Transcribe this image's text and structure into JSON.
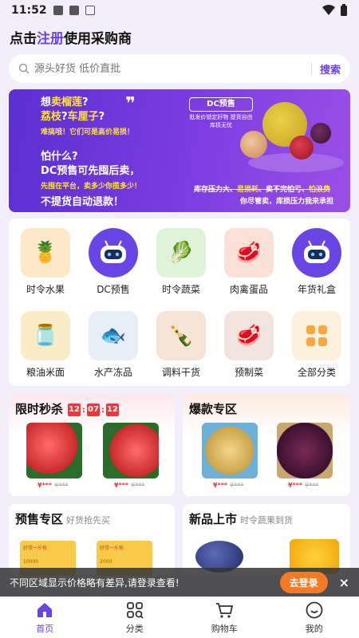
{
  "statusbar": {
    "time": "11:52"
  },
  "header": {
    "title_prefix": "点击",
    "title_link": "注册",
    "title_suffix": "使用采购商"
  },
  "search": {
    "placeholder": "源头好货 低价直批",
    "button": "搜索"
  },
  "banner": {
    "line1a": "想",
    "line1b": "卖榴莲",
    "line1c": "?",
    "line1d": "荔枝",
    "line1e": "?",
    "line1f": "车厘子",
    "line1g": "?",
    "line2": "难搞哦！它们可是高价易损！",
    "line3a": "怕什么?",
    "line3b": "DC预售可先囤后卖，",
    "line4": "先囤在平台，卖多少你揽多少！",
    "line5": "不提货自动退款！",
    "badge": "DC预售",
    "sub1": "批发价锁定好物 提货自由库损无忧",
    "strike_a": "库存压力大、",
    "strike_b": "易损耗",
    "strike_c": "、卖不完怕亏、",
    "strike_d": "怕浪费",
    "sub2": "你尽管卖，库损压力我来承担"
  },
  "categories": [
    {
      "label": "时令水果",
      "icon": "pineapple-icon",
      "color": "#fde9c8"
    },
    {
      "label": "DC预售",
      "icon": "robot-icon",
      "color": "#6a45e6"
    },
    {
      "label": "时令蔬菜",
      "icon": "vegetable-icon",
      "color": "#dff3d8"
    },
    {
      "label": "肉禽蛋品",
      "icon": "meat-icon",
      "color": "#fbe0d8"
    },
    {
      "label": "年货礼盒",
      "icon": "robot-icon",
      "color": "#6a45e6"
    },
    {
      "label": "粮油米面",
      "icon": "oil-icon",
      "color": "#fbecc8"
    },
    {
      "label": "水产冻品",
      "icon": "fish-icon",
      "color": "#e8eef5"
    },
    {
      "label": "调料干货",
      "icon": "bottle-icon",
      "color": "#f5e4d5"
    },
    {
      "label": "预制菜",
      "icon": "steak-icon",
      "color": "#f2e5e0"
    },
    {
      "label": "全部分类",
      "icon": "grid-icon",
      "color": "#fdf0dc"
    }
  ],
  "flash": {
    "title": "限时秒杀",
    "h": "12",
    "m": "07",
    "s": "12",
    "price": "¥***",
    "old": "¥***"
  },
  "hot": {
    "title": "爆款专区",
    "price": "¥***",
    "old": "¥***"
  },
  "presale": {
    "title": "预售专区",
    "sub": "好货抢先买",
    "card1": "好货一斤抢",
    "card2": "好货一斤抢",
    "num1": "10000",
    "num2": "2000"
  },
  "newarr": {
    "title": "新品上市",
    "sub": "时令蔬果到货"
  },
  "toast": {
    "message": "不同区域显示价格略有差异,请登录查看!",
    "button": "去登录",
    "close": "×"
  },
  "tabs": [
    {
      "label": "首页"
    },
    {
      "label": "分类"
    },
    {
      "label": "购物车"
    },
    {
      "label": "我的"
    }
  ]
}
